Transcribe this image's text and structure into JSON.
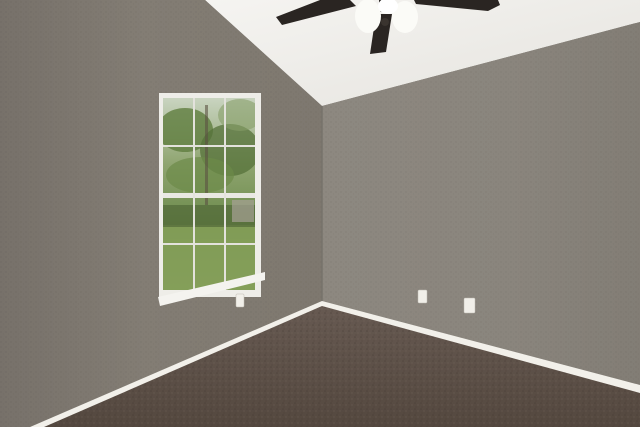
{
  "scene": {
    "subject": "empty-bedroom",
    "elements": {
      "ceiling": "vaulted-ceiling",
      "fan": "ceiling-fan-with-light",
      "window": "double-hung-window",
      "floor": "carpet",
      "outlets": 2
    },
    "colors": {
      "wall_left": "#837d74",
      "wall_right": "#8a857d",
      "ceiling": "#f0eeea",
      "trim": "#f2f0ea",
      "carpet": "#5d514a",
      "foliage": "#6f8f4d"
    }
  }
}
